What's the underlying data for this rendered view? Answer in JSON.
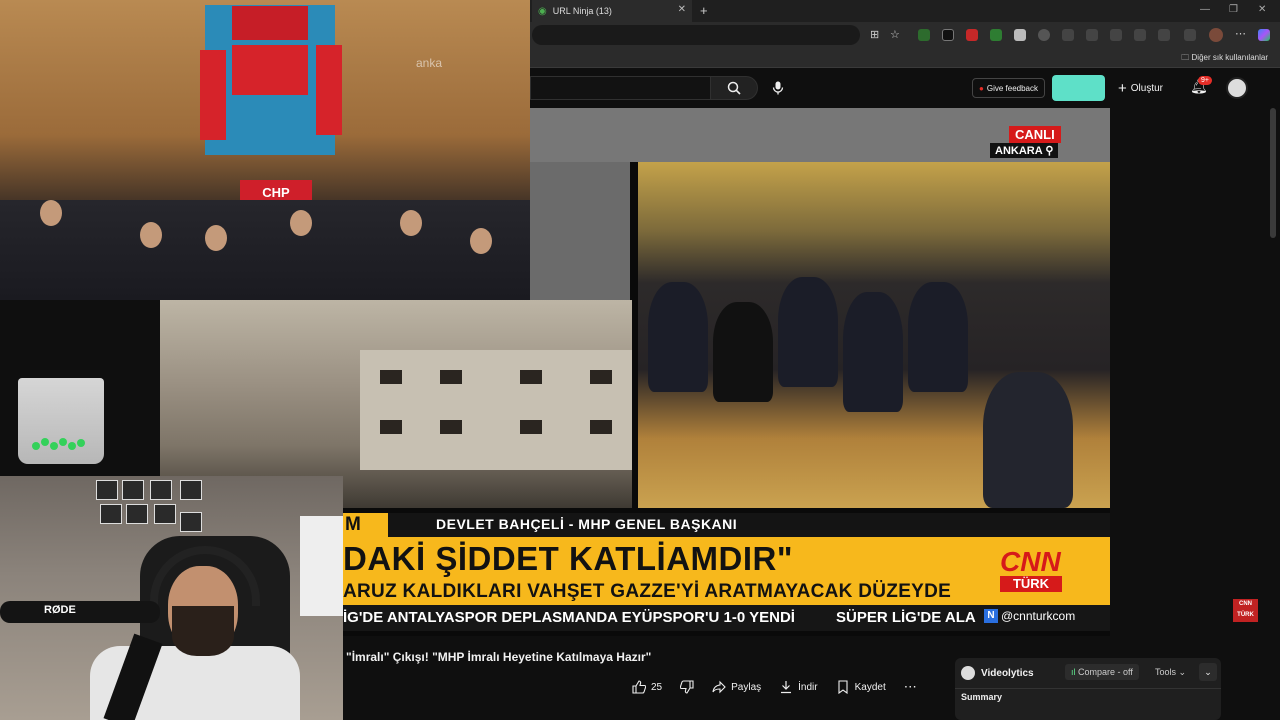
{
  "browser": {
    "tab_title": "URL Ninja (13)",
    "bookmarks_label": "Diğer sık kullanılanlar"
  },
  "youtube": {
    "give_feedback": "Give feedback",
    "create_label": "Oluştur",
    "notifications_badge": "9+"
  },
  "broadcast": {
    "live_label": "CANLI",
    "location": "ANKARA",
    "lower_third_tag": "M",
    "speaker": "DEVLET BAHÇELİ - MHP GENEL BAŞKANI",
    "headline": "DAKİ ŞİDDET KATLİAMDIR\"",
    "subheadline": "ARUZ KALDIKLARI VAHŞET GAZZE'Yİ ARATMAYACAK DÜZEYDE",
    "ticker_1": "İG'DE ANTALYASPOR DEPLASMANDA EYÜPSPOR'U 1-0 YENDİ",
    "ticker_2": "SÜPER LİG'DE ALAN",
    "handle": "@cnnturkcom",
    "channel_logo": "CNN",
    "channel_logo_sub": "TÜRK",
    "overlay_watermark": "anka",
    "party_podium": "CHP",
    "mic_brand": "RØDE"
  },
  "video": {
    "title": "\"İmralı\" Çıkışı! \"MHP İmralı Heyetine Katılmaya Hazır\"",
    "like_count": "25",
    "share_label": "Paylaş",
    "download_label": "İndir",
    "save_label": "Kaydet"
  },
  "videolytics": {
    "title": "Videolytics",
    "compare": "Compare - off",
    "tools": "Tools",
    "summary": "Summary"
  },
  "colors": {
    "cnn_red": "#d61a1a",
    "ticker_yellow": "#f7b81c",
    "accent_pill": "#5ee0c8"
  }
}
